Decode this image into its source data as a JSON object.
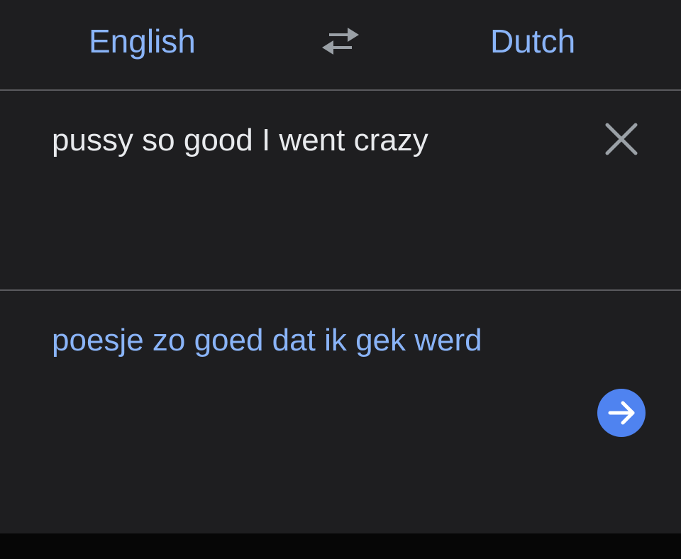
{
  "languages": {
    "source": "English",
    "target": "Dutch"
  },
  "input": {
    "text": "pussy so good I went crazy"
  },
  "output": {
    "text": "poesje zo goed dat ik gek werd"
  },
  "icons": {
    "swap": "swap-arrows-icon",
    "clear": "close-icon",
    "go": "arrow-right-icon"
  },
  "colors": {
    "background": "#1e1e20",
    "accent": "#8ab4f8",
    "button": "#4f83f0",
    "text": "#e8eaed",
    "divider": "#5a5a5e"
  }
}
